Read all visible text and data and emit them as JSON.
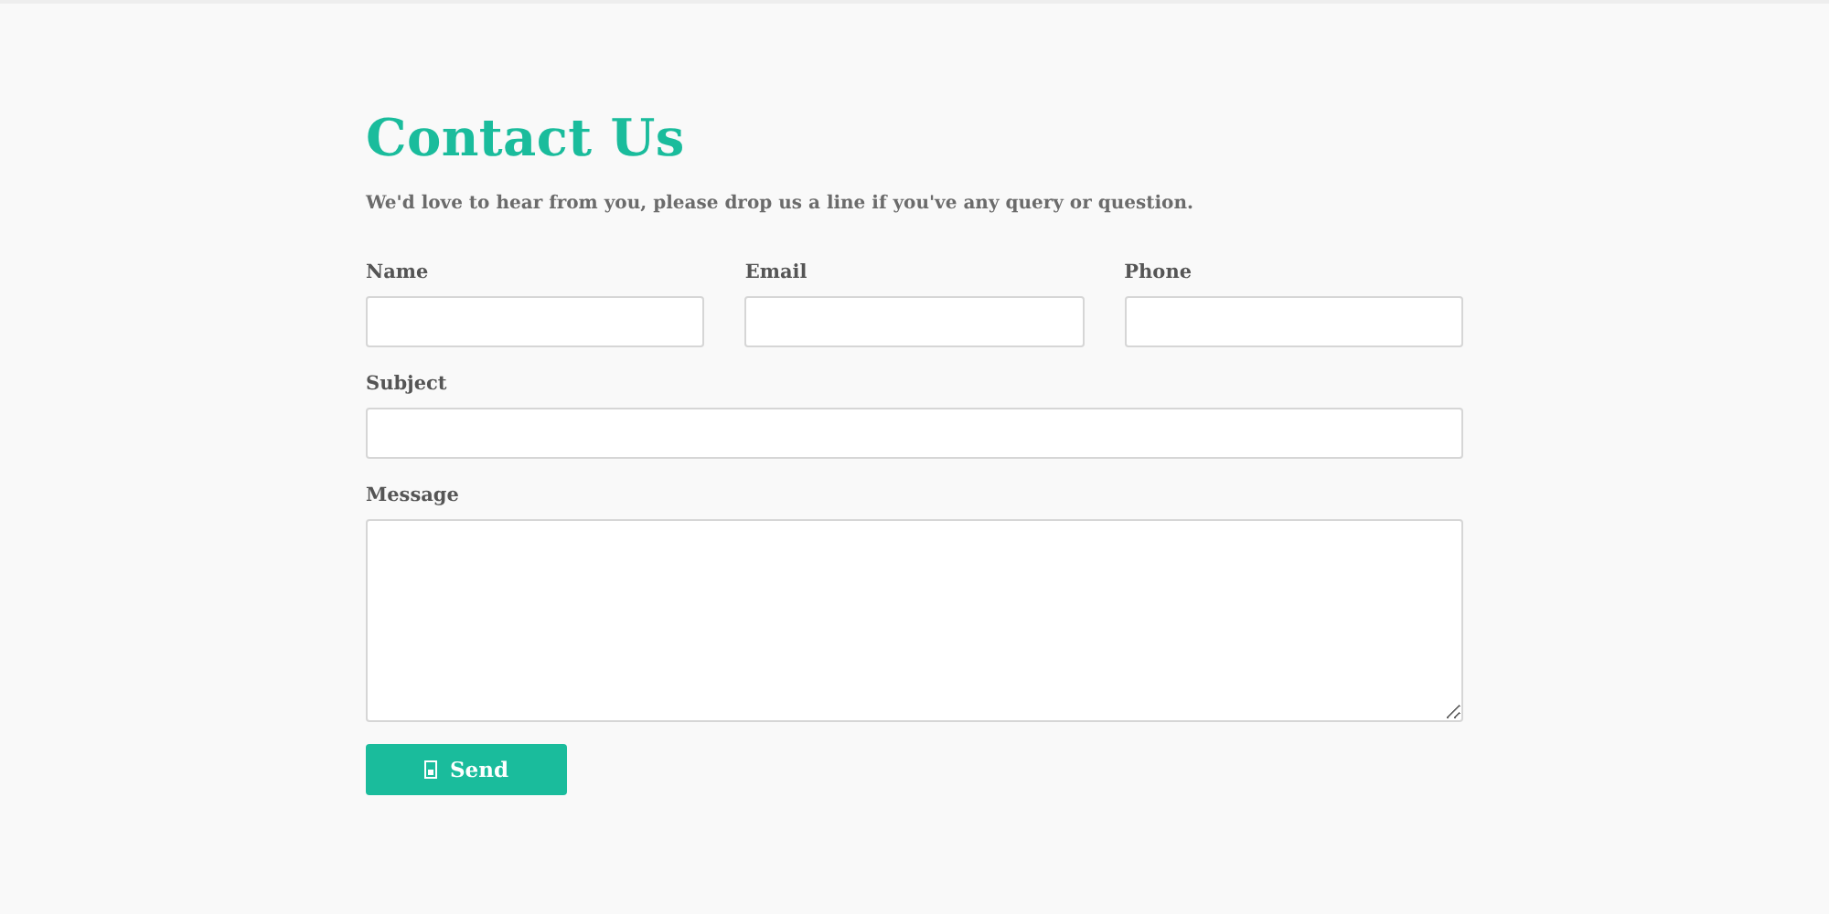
{
  "title": "Contact Us",
  "intro": "We'd love to hear from you, please drop us a line if you've any query or question.",
  "fields": [
    {
      "label": "Name",
      "kind": "input"
    },
    {
      "label": "Email",
      "kind": "input"
    },
    {
      "label": "Phone",
      "kind": "input"
    },
    {
      "label": "Subject",
      "kind": "input"
    },
    {
      "label": "Message",
      "kind": "textarea"
    }
  ],
  "submit": {
    "label": "Send"
  }
}
